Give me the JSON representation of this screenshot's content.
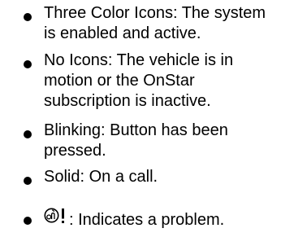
{
  "items": [
    {
      "lines": [
        "Three Color Icons: The system",
        "is enabled and active."
      ]
    },
    {
      "lines": [
        "No Icons: The vehicle is in",
        "motion or the OnStar",
        "subscription is inactive."
      ]
    },
    {
      "lines": [
        "Blinking: Button has been",
        "pressed."
      ]
    },
    {
      "lines": [
        "Solid: On a call."
      ]
    },
    {
      "icon": "onstar-alert-icon",
      "lines": [
        ": Indicates a problem."
      ]
    }
  ]
}
